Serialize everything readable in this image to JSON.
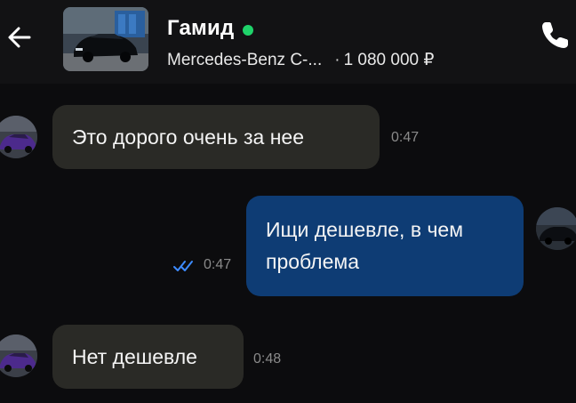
{
  "header": {
    "contact_name": "Гамид",
    "listing_title": "Mercedes-Benz C-...",
    "separator": "·",
    "listing_price": "1 080 000 ₽",
    "online_color": "#1fd36a",
    "icons": {
      "back": "arrow-left-icon",
      "call": "phone-icon"
    }
  },
  "messages": [
    {
      "direction": "incoming",
      "text": "Это дорого очень за нее",
      "time": "0:47"
    },
    {
      "direction": "outgoing",
      "text_line1": "Ищи дешевле, в чем",
      "text_line2": "проблема",
      "time": "0:47",
      "status": "read"
    },
    {
      "direction": "incoming",
      "text": "Нет дешевле",
      "time": "0:48"
    }
  ],
  "colors": {
    "background": "#0c0c0e",
    "incoming_bubble": "#2a2a26",
    "outgoing_bubble": "#0e3c74",
    "read_ticks": "#3d8bff"
  }
}
